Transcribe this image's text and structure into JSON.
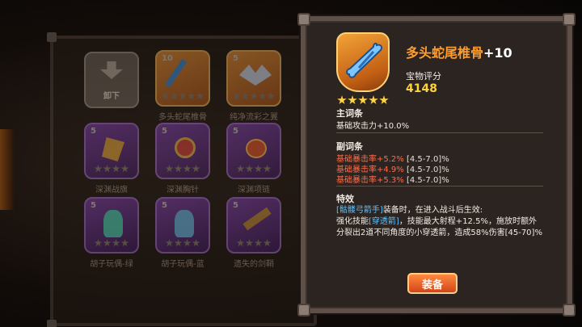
{
  "inventory": {
    "unload_label": "卸下",
    "items": [
      {
        "level": "10",
        "label": "多头蛇尾椎骨",
        "color": "#c46a18"
      },
      {
        "level": "5",
        "label": "纯净流彩之翼",
        "color": "#c46a18"
      },
      {
        "level": "5",
        "label": "深渊战旗",
        "color": "#5a2f7a"
      },
      {
        "level": "5",
        "label": "深渊胸针",
        "color": "#5a2f7a"
      },
      {
        "level": "5",
        "label": "深渊项链",
        "color": "#5a2f7a"
      },
      {
        "level": "5",
        "label": "胡子玩偶-绿",
        "color": "#5a2f7a"
      },
      {
        "level": "5",
        "label": "胡子玩偶-蓝",
        "color": "#5a2f7a"
      },
      {
        "level": "5",
        "label": "遗失的剑鞘",
        "color": "#5a2f7a"
      }
    ]
  },
  "detail": {
    "item_name": "多头蛇尾椎骨",
    "item_plus": "+10",
    "rating_label": "宝物评分",
    "rating_value": "4148",
    "stars": 5,
    "main_title": "主词条",
    "main_line": "基础攻击力+10.0%",
    "sub_title": "副词条",
    "sub_rows": [
      {
        "name": "基础暴击率+5.2%",
        "range": "[4.5-7.0]%"
      },
      {
        "name": "基础暴击率+4.9%",
        "range": "[4.5-7.0]%"
      },
      {
        "name": "基础暴击率+5.3%",
        "range": "[4.5-7.0]%"
      }
    ],
    "special_title": "特效",
    "special_tag": "[骷髅弓箭手]",
    "special_line1": "装备时，在进入战斗后生效:",
    "special_line2_pre": "强化技能",
    "special_line2_tag": "[穿透箭]",
    "special_line2_post": "，技能最大射程+12.5%，施放时额外分裂出2道不同角度的小穿透箭，造成58%伤害[45-70]%",
    "equip_label": "装备"
  },
  "colors": {
    "name": "#ff9d2e",
    "rating": "#ffd43a",
    "sub_stat": "#ff6b4a",
    "skill_tag": "#5fc2ff"
  }
}
